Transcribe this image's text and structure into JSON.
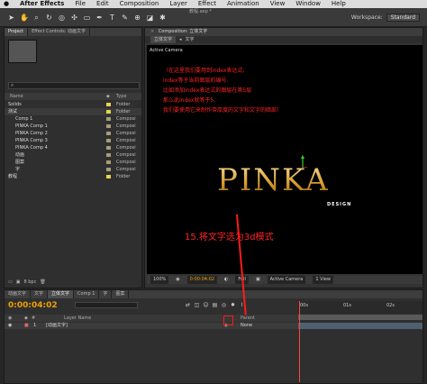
{
  "menubar": {
    "app": "After Effects",
    "items": [
      "File",
      "Edit",
      "Composition",
      "Layer",
      "Effect",
      "Animation",
      "View",
      "Window",
      "Help"
    ]
  },
  "toolbar": {
    "window_title": "教程.aep *",
    "workspace_label": "Workspace:",
    "workspace_value": "Standard"
  },
  "project_panel": {
    "tab_project": "Project",
    "tab_effect_controls": "Effect Controls: 动画文字",
    "col_name": "Name",
    "col_type": "Type",
    "items": [
      {
        "name": "Solids",
        "type": "Folder",
        "label_color": "#e8d44d"
      },
      {
        "name": "测试",
        "type": "Folder",
        "label_color": "#e8d44d"
      },
      {
        "name": "Comp 1",
        "type": "Composi",
        "label_color": "#a89c7a"
      },
      {
        "name": "PINKA Comp 1",
        "type": "Composi",
        "label_color": "#a89c7a"
      },
      {
        "name": "PINKA Comp 2",
        "type": "Composi",
        "label_color": "#a89c7a"
      },
      {
        "name": "PINKA Comp 3",
        "type": "Composi",
        "label_color": "#a89c7a"
      },
      {
        "name": "PINKA Comp 4",
        "type": "Composi",
        "label_color": "#a89c7a"
      },
      {
        "name": "动画",
        "type": "Composi",
        "label_color": "#a89c7a"
      },
      {
        "name": "图案",
        "type": "Composi",
        "label_color": "#a89c7a"
      },
      {
        "name": "字",
        "type": "Composi",
        "label_color": "#a89c7a"
      },
      {
        "name": "教程",
        "type": "Folder",
        "label_color": "#e8d44d"
      }
    ],
    "bpc": "8 bpc"
  },
  "composition_panel": {
    "tab_title": "Composition: 立体文字",
    "subtabs": [
      "立体文字",
      "文字"
    ],
    "active_camera": "Active Camera",
    "annotation_lines": [
      "（在这里我们要用到index表达式,",
      "index等于当前图层的编号.",
      "比如添加index表达式的图层在第5层",
      "那么此index就等于5.",
      "我们要使用它来制作带厚度的文字和文字的暗部）"
    ],
    "logo_text": "PINKA",
    "logo_subtext": "DESIGN",
    "step_text": "15.将文字选为3d模式",
    "footer": {
      "zoom": "100%",
      "timecode": "0:00:04:02",
      "resolution": "Full",
      "view": "Active Camera",
      "view_count": "1 View"
    }
  },
  "timeline": {
    "tabs": [
      "动画文字",
      "文字",
      "立体文字",
      "Comp 1",
      "字",
      "图案"
    ],
    "active_tab_index": 2,
    "timecode": "0:00:04:02",
    "col_layer_name": "Layer Name",
    "col_parent": "Parent",
    "layer": {
      "index": "1",
      "name": "[动画文字]",
      "parent": "None"
    },
    "ruler_labels": [
      "00s",
      "01s",
      "02s"
    ]
  }
}
